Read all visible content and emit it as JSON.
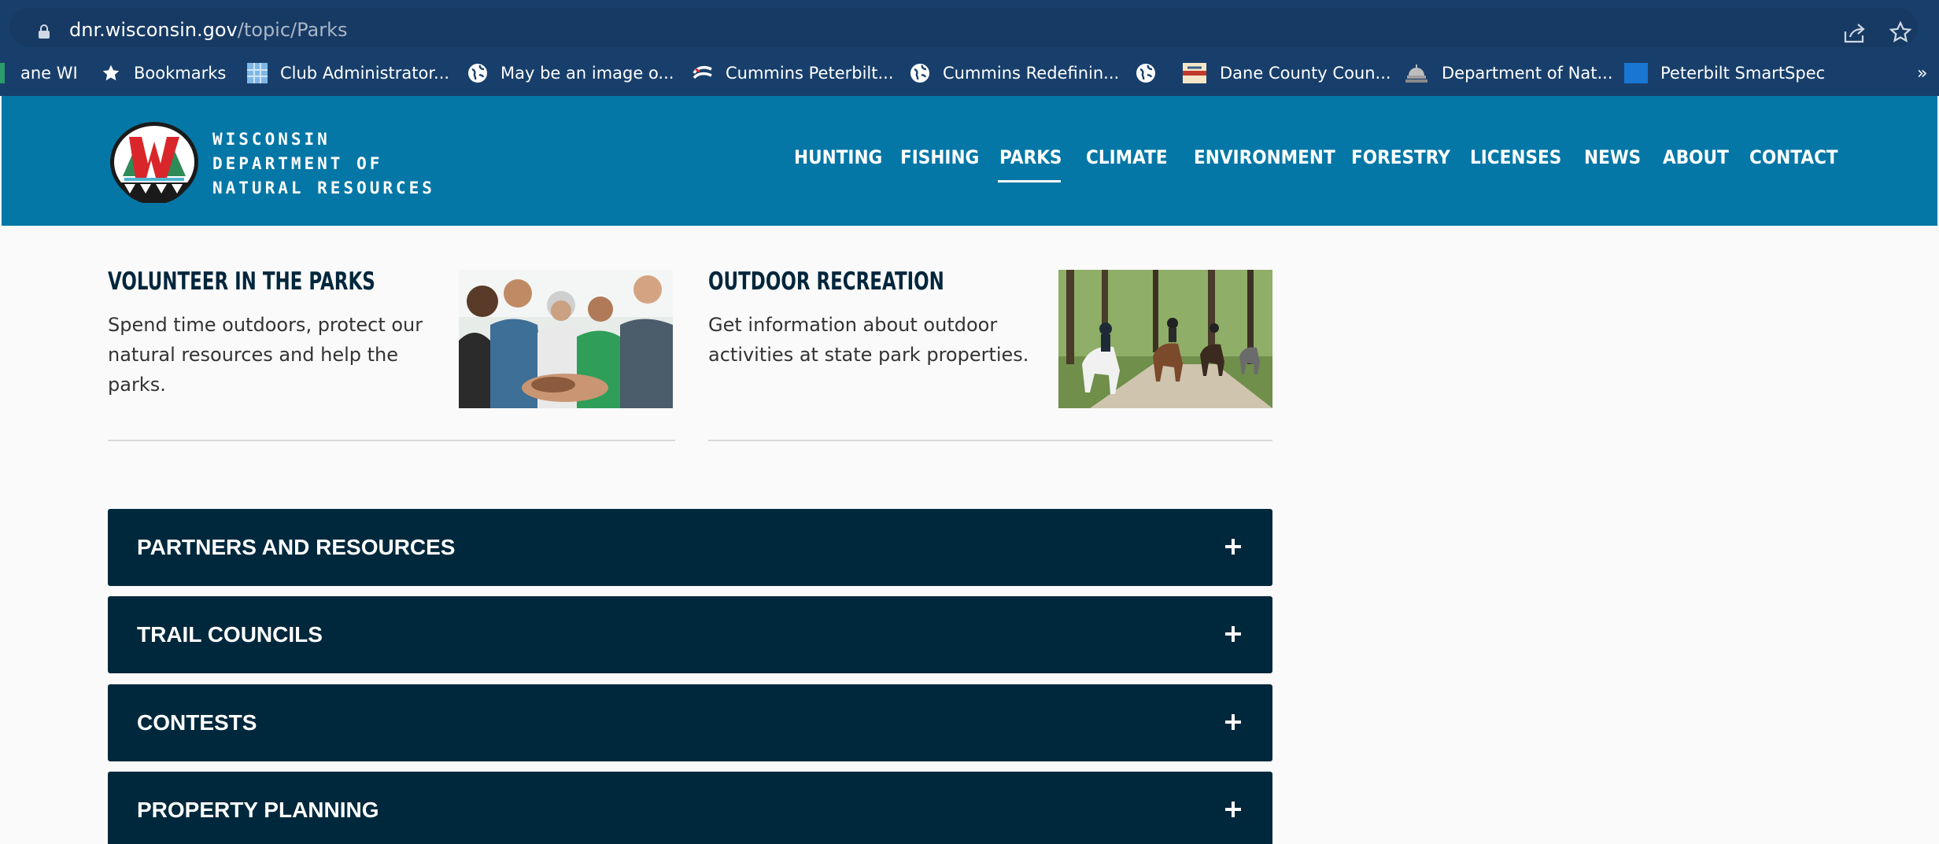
{
  "browser": {
    "url_domain": "dnr.wisconsin.gov",
    "url_path": "/topic/Parks",
    "bookmarks": [
      {
        "label": "ane WI",
        "icon": "bookmark-favicon"
      },
      {
        "label": "Bookmarks",
        "icon": "star-icon"
      },
      {
        "label": "Club Administrator...",
        "icon": "grid-favicon"
      },
      {
        "label": "May be an image o...",
        "icon": "globe-icon"
      },
      {
        "label": "Cummins Peterbilt...",
        "icon": "cummins-favicon"
      },
      {
        "label": "Cummins Redefinin...",
        "icon": "globe-icon"
      },
      {
        "label": "",
        "icon": "globe-icon"
      },
      {
        "label": "Dane County Coun...",
        "icon": "dane-county-favicon"
      },
      {
        "label": "Department of Nat...",
        "icon": "capitol-favicon"
      },
      {
        "label": "Peterbilt SmartSpec",
        "icon": "peterbilt-favicon"
      }
    ],
    "overflow": "»"
  },
  "header": {
    "logo_lines": [
      "WISCONSIN",
      "DEPARTMENT OF",
      "NATURAL RESOURCES"
    ],
    "nav": [
      "HUNTING",
      "FISHING",
      "PARKS",
      "CLIMATE",
      "ENVIRONMENT",
      "FORESTRY",
      "LICENSES",
      "NEWS",
      "ABOUT",
      "CONTACT"
    ],
    "active_nav": "PARKS"
  },
  "cards": [
    {
      "title": "VOLUNTEER IN THE PARKS",
      "text": "Spend time outdoors, protect our natural resources and help the parks.",
      "image": "group-hands-together-photo"
    },
    {
      "title": "OUTDOOR RECREATION",
      "text": "Get information about outdoor activities at state park properties.",
      "image": "horseback-riders-trail-photo"
    }
  ],
  "accordion": [
    {
      "label": "PARTNERS AND RESOURCES"
    },
    {
      "label": "TRAIL COUNCILS"
    },
    {
      "label": "CONTESTS"
    },
    {
      "label": "PROPERTY PLANNING"
    }
  ],
  "colors": {
    "browser_bar": "#183f6b",
    "header_blue": "#0477a6",
    "accordion_navy": "#00283c",
    "title_navy": "#00263c"
  }
}
